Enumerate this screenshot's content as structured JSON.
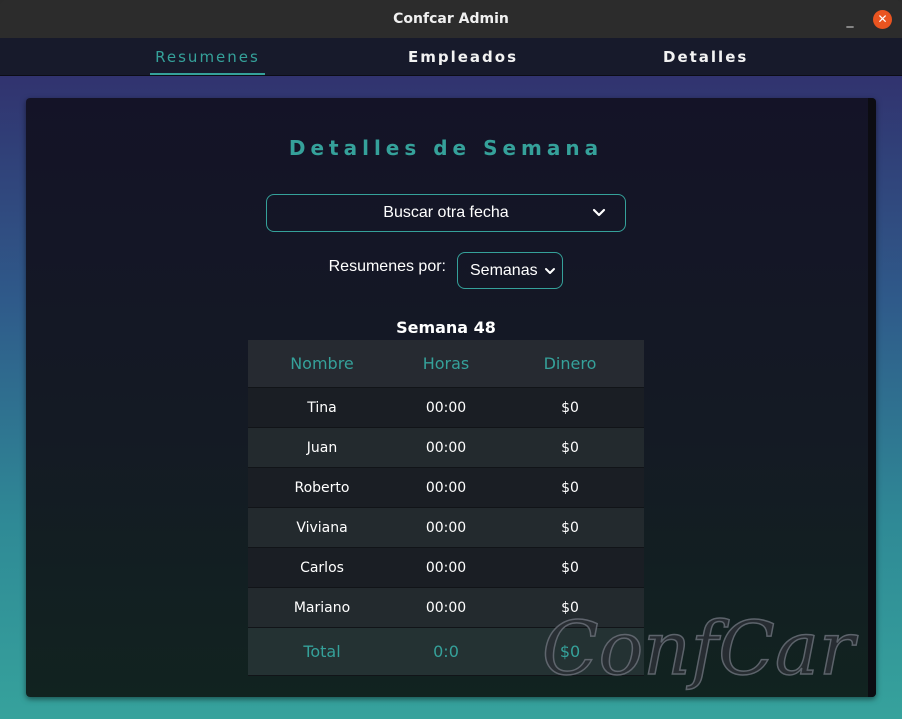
{
  "window": {
    "title": "Confcar Admin",
    "minimize_glyph": "_",
    "close_glyph": "✕"
  },
  "nav": {
    "tabs": [
      {
        "label": "Resumenes",
        "active": true
      },
      {
        "label": "Empleados",
        "active": false
      },
      {
        "label": "Detalles",
        "active": false
      }
    ]
  },
  "page": {
    "title": "Detalles de Semana",
    "date_picker_label": "Buscar otra fecha",
    "period_label": "Resumenes por:",
    "period_value": "Semanas",
    "week_title": "Semana 48"
  },
  "table": {
    "headers": [
      "Nombre",
      "Horas",
      "Dinero"
    ],
    "rows": [
      [
        "Tina",
        "00:00",
        "$0"
      ],
      [
        "Juan",
        "00:00",
        "$0"
      ],
      [
        "Roberto",
        "00:00",
        "$0"
      ],
      [
        "Viviana",
        "00:00",
        "$0"
      ],
      [
        "Carlos",
        "00:00",
        "$0"
      ],
      [
        "Mariano",
        "00:00",
        "$0"
      ]
    ],
    "footer": [
      "Total",
      "0:0",
      "$0"
    ]
  },
  "watermark": {
    "text": "ConfCar"
  },
  "colors": {
    "accent": "#35a19a",
    "close": "#e95420"
  },
  "icons": {
    "date_picker": "chevron-down-icon",
    "period": "chevron-down-icon"
  }
}
